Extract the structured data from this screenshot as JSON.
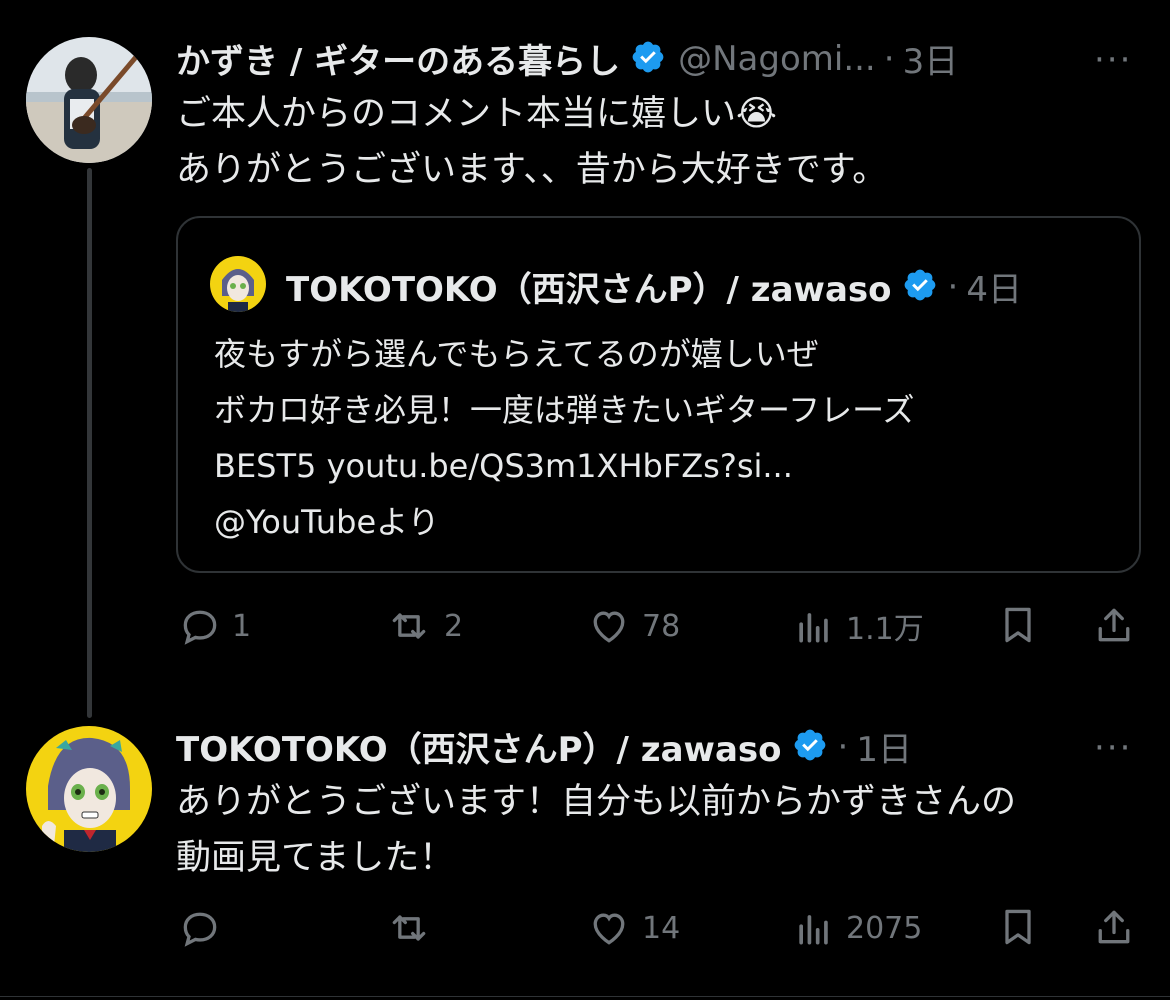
{
  "tweet1": {
    "name": "かずき / ギターのある暮らし",
    "handle": "@Nagomi...",
    "sep": "·",
    "time": "3日",
    "line1": "ご本人からのコメント本当に嬉しい😭",
    "line2": "ありがとうございます、、昔から大好きです。",
    "more": "···",
    "quote": {
      "name": "TOKOTOKO（西沢さんP）/ zawaso",
      "sep": "·",
      "time": "4日",
      "lines": [
        "夜もすがら選んでもらえてるのが嬉しいぜ",
        "ボカロ好き必見！一度は弾きたいギターフレーズ",
        "BEST5 youtu.be/QS3m1XHbFZs?si...",
        "@YouTubeより"
      ]
    },
    "actions": {
      "reply": "1",
      "retweet": "2",
      "like": "78",
      "views": "1.1万"
    }
  },
  "tweet2": {
    "name": "TOKOTOKO（西沢さんP）/ zawaso",
    "sep": "·",
    "time": "1日",
    "line1": "ありがとうございます！自分も以前からかずきさんの",
    "line2": "動画見てました！",
    "more": "···",
    "actions": {
      "reply": "",
      "retweet": "",
      "like": "14",
      "views": "2075"
    }
  },
  "colors": {
    "verified": "#1d9bf0",
    "muted": "#71767b",
    "text": "#e7e9ea",
    "border": "#2f3336"
  },
  "icons": [
    "reply-icon",
    "retweet-icon",
    "like-icon",
    "views-icon",
    "bookmark-icon",
    "share-icon",
    "verified-icon",
    "more-icon"
  ]
}
